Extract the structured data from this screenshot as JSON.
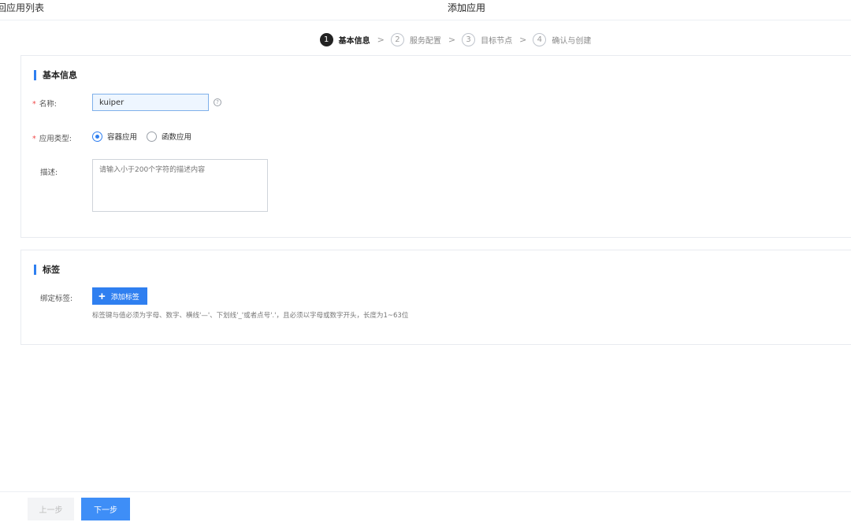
{
  "header": {
    "back_label": "回应用列表",
    "title": "添加应用"
  },
  "steps": [
    {
      "num": "1",
      "label": "基本信息",
      "active": true
    },
    {
      "num": "2",
      "label": "服务配置",
      "active": false
    },
    {
      "num": "3",
      "label": "目标节点",
      "active": false
    },
    {
      "num": "4",
      "label": "确认与创建",
      "active": false
    }
  ],
  "basic_info": {
    "section_title": "基本信息",
    "name_label": "名称:",
    "name_value": "kuiper",
    "type_label": "应用类型:",
    "type_options": [
      "容器应用",
      "函数应用"
    ],
    "type_selected": "容器应用",
    "desc_label": "描述:",
    "desc_placeholder": "请输入小于200个字符的描述内容"
  },
  "tags": {
    "section_title": "标签",
    "bind_label": "绑定标签:",
    "add_button": "添加标签",
    "hint": "标签键与值必须为字母、数字、横线'—'、下划线'_'或者点号'.'，且必须以字母或数字开头，长度为1~63位"
  },
  "footer": {
    "prev_label": "上一步",
    "next_label": "下一步"
  },
  "colors": {
    "accent": "#2f7ff0",
    "required": "#f04a4a"
  }
}
